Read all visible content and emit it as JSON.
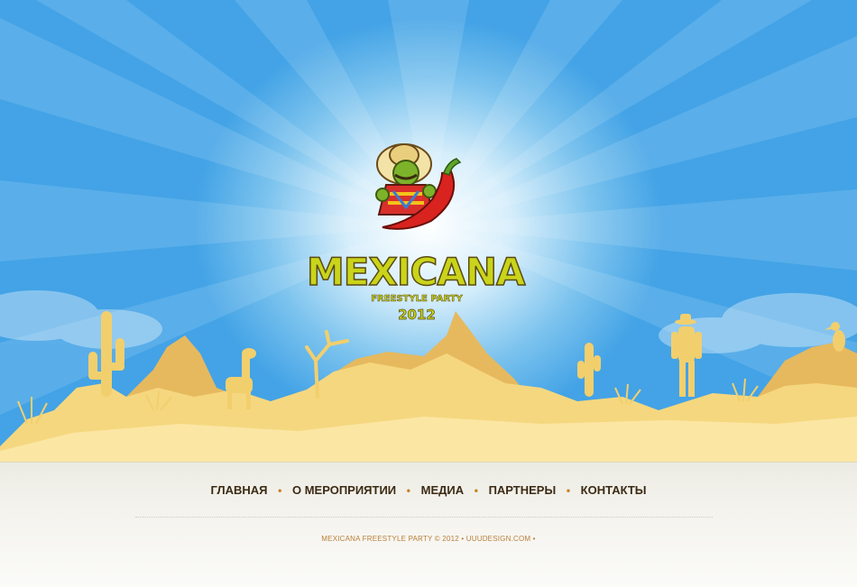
{
  "logo": {
    "title": "MEXICANA",
    "subtitle": "FREESTYLE PARTY",
    "year": "2012"
  },
  "nav": {
    "items": [
      {
        "label": "ГЛАВНАЯ"
      },
      {
        "label": "О МЕРОПРИЯТИИ"
      },
      {
        "label": "МЕДИА"
      },
      {
        "label": "ПАРТНЕРЫ"
      },
      {
        "label": "КОНТАКТЫ"
      }
    ],
    "separator": "•"
  },
  "footer": {
    "copyright": "MEXICANA FREESTYLE PARTY © 2012",
    "credit": "• UUUDESIGN.COM •"
  },
  "colors": {
    "sky": "#43a3e6",
    "sand": "#f7db86",
    "sand_dark": "#e6b95e",
    "nav_text": "#3c2a14",
    "accent": "#c57f1e"
  },
  "icons": [
    "mascot-icon",
    "chili-pepper-icon",
    "cactus-icon",
    "cowboy-icon",
    "bird-icon",
    "llama-icon"
  ]
}
